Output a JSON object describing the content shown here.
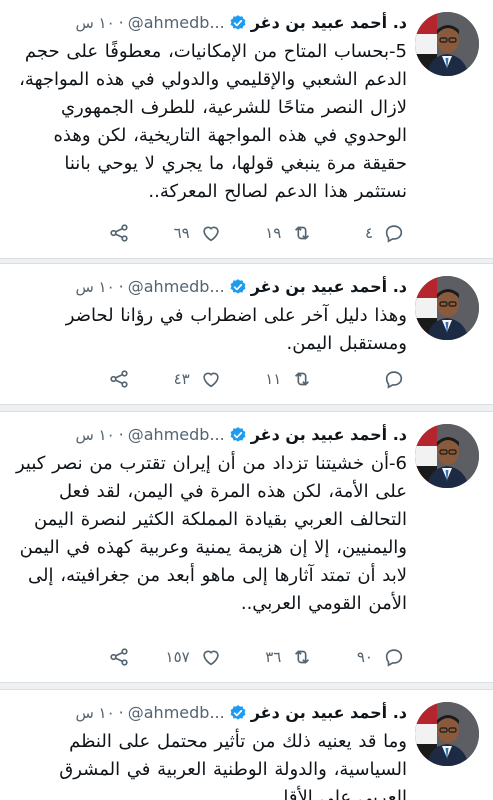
{
  "colors": {
    "verified": "#1d9bf0",
    "muted": "#536471",
    "text": "#0f1419",
    "separator": "#eef0f2"
  },
  "tweets": [
    {
      "name": "د. أحمد عبيد بن دغر",
      "handle": "@ahmedb...",
      "dot": "·",
      "time": "١٠ س",
      "text": "5-بحساب المتاح من الإمكانيات، معطوفًا على حجم الدعم الشعبي والإقليمي والدولي في هذه المواجهة، لازال النصر متاحًا للشرعية، للطرف الجمهوري الوحدوي في هذه المواجهة التاريخية، لكن وهذه حقيقة مرة ينبغي قولها، ما يجري لا يوحي باننا نستثمر هذا الدعم لصالح المعركة..",
      "replies": "٤",
      "retweets": "١٩",
      "likes": "٦٩",
      "share": ""
    },
    {
      "name": "د. أحمد عبيد بن دغر",
      "handle": "@ahmedb...",
      "dot": "·",
      "time": "١٠ س",
      "text": "وهذا دليل آخر على اضطراب في رؤانا لحاضر ومستقبل اليمن.",
      "replies": "",
      "retweets": "١١",
      "likes": "٤٣",
      "share": ""
    },
    {
      "name": "د. أحمد عبيد بن دغر",
      "handle": "@ahmedb...",
      "dot": "·",
      "time": "١٠ س",
      "text": "6-أن خشيتنا تزداد من أن إيران تقترب من نصر كبير على الأمة، لكن هذه المرة في اليمن، لقد فعل التحالف العربي بقيادة المملكة الكثير لنصرة اليمن واليمنيين، إلا إن هزيمة يمنية وعربية كهذه في اليمن لابد أن تمتد آثارها إلى ماهو أبعد من جغرافيته، إلى الأمن القومي العربي..",
      "replies": "٩٠",
      "retweets": "٣٦",
      "likes": "١٥٧",
      "share": ""
    },
    {
      "name": "د. أحمد عبيد بن دغر",
      "handle": "@ahmedb...",
      "dot": "·",
      "time": "١٠ س",
      "text": "وما قد يعنيه ذلك من تأثير محتمل على النظم السياسية، والدولة الوطنية العربية في المشرق العربي على الأقل.",
      "replies": "",
      "retweets": "",
      "likes": "",
      "share": ""
    }
  ]
}
